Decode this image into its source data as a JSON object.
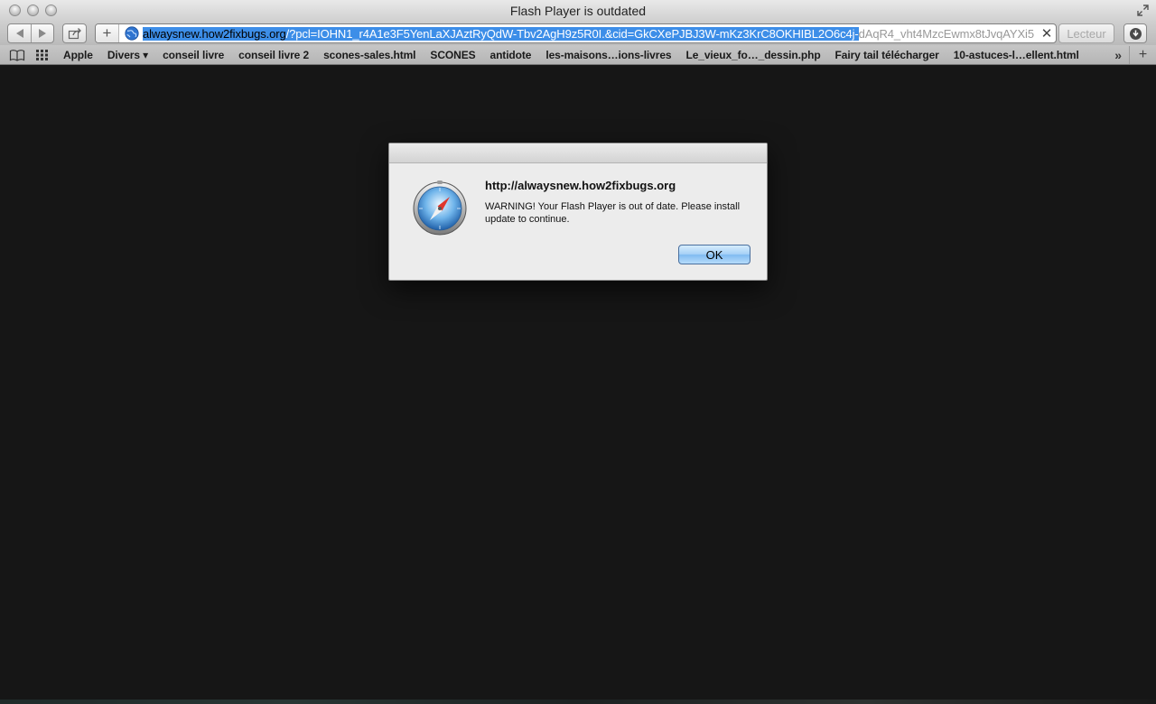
{
  "window": {
    "title": "Flash Player is outdated"
  },
  "toolbar": {
    "add_label": "+",
    "url_host": "alwaysnew.how2fixbugs.org",
    "url_query_selected": "/?pcl=IOHN1_r4A1e3F5YenLaXJAztRyQdW-Tbv2AgH9z5R0I.&cid=GkCXePJBJ3W-mKz3KrC8OKHIBL2O6c4j-",
    "url_query_rest": "dAqR4_vht4MzcEwmx8tJvqAYXi5",
    "clear_label": "✕",
    "reader_label": "Lecteur"
  },
  "bookmarks": {
    "items": [
      "Apple",
      "Divers ▾",
      "conseil livre",
      "conseil livre 2",
      "scones-sales.html",
      "SCONES",
      "antidote",
      "les-maisons…ions-livres",
      "Le_vieux_fo…_dessin.php",
      "Fairy tail télécharger",
      "10-astuces-l…ellent.html"
    ],
    "more_label": "»",
    "new_tab_label": "+"
  },
  "dialog": {
    "title": "http://alwaysnew.how2fixbugs.org",
    "message": "WARNING! Your Flash Player is out of date. Please install update to continue.",
    "ok_label": "OK"
  },
  "colors": {
    "page_background": "#161616",
    "url_selection": "#3d8ee8",
    "ok_button": "#80bbf1"
  },
  "icons": {
    "dialog": "safari-compass-icon",
    "address": "globe-icon"
  }
}
